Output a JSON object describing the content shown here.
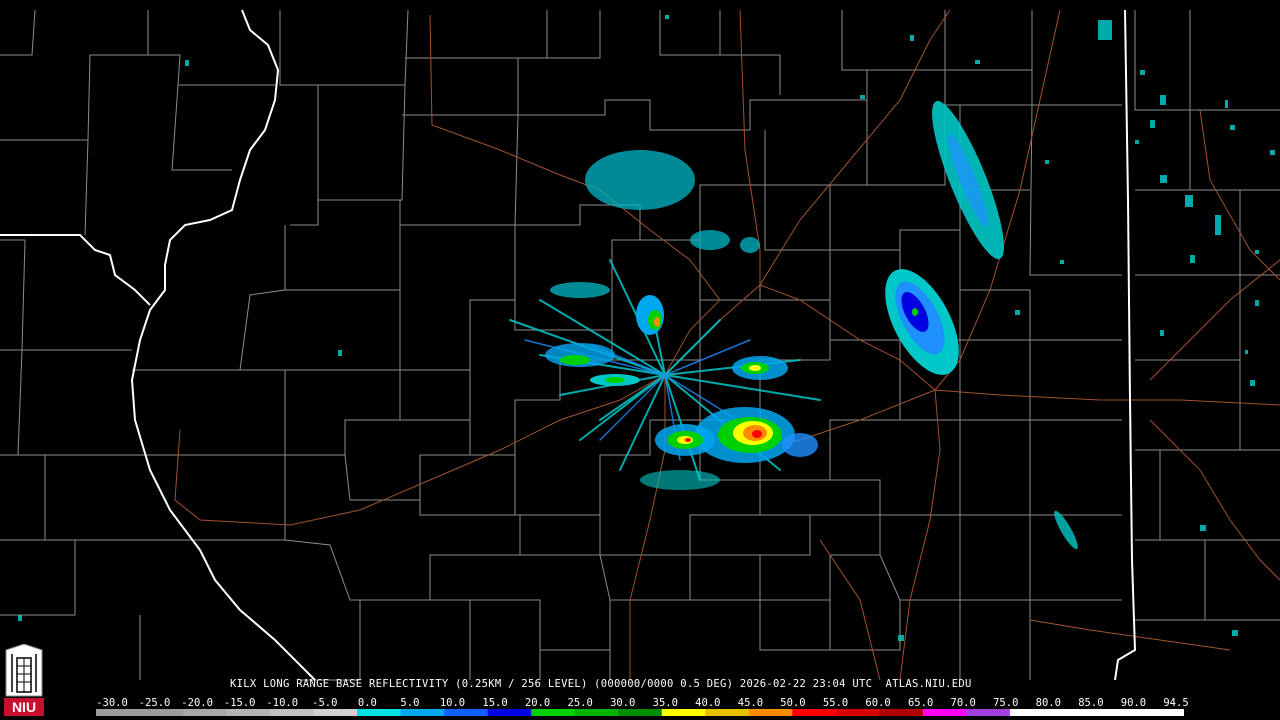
{
  "product": {
    "caption": "KILX LONG RANGE BASE REFLECTIVITY (0.25KM / 256 LEVEL) (000000/0000 0.5 DEG) 2026-02-22 23:04 UTC  ATLAS.NIU.EDU"
  },
  "logo": {
    "text": "NIU",
    "icon": "university-tower-icon",
    "color": "#c8102e"
  },
  "colors": {
    "background": "#000000",
    "county_lines": "#8c8c8c",
    "state_lines": "#ffffff",
    "roads": "#a0522d"
  },
  "scale": {
    "labels": [
      "-30.0",
      "-25.0",
      "-20.0",
      "-15.0",
      "-10.0",
      "-5.0",
      "0.0",
      "5.0",
      "10.0",
      "15.0",
      "20.0",
      "25.0",
      "30.0",
      "35.0",
      "40.0",
      "45.0",
      "50.0",
      "55.0",
      "60.0",
      "65.0",
      "70.0",
      "75.0",
      "80.0",
      "85.0",
      "90.0",
      "94.5"
    ],
    "colors": [
      "#9c9c9c",
      "#9c9c9c",
      "#a8a8a8",
      "#b4b4b4",
      "#c0c0c0",
      "#d0d0d0",
      "#00e0e0",
      "#00a8f0",
      "#1060ff",
      "#0000e0",
      "#00d000",
      "#00b400",
      "#008c00",
      "#ffff00",
      "#e8c000",
      "#ff8c00",
      "#ff0000",
      "#d80000",
      "#b00000",
      "#ff00ff",
      "#a040e0",
      "#ffffff",
      "#ffffff",
      "#ffffff",
      "#ffffff"
    ]
  }
}
